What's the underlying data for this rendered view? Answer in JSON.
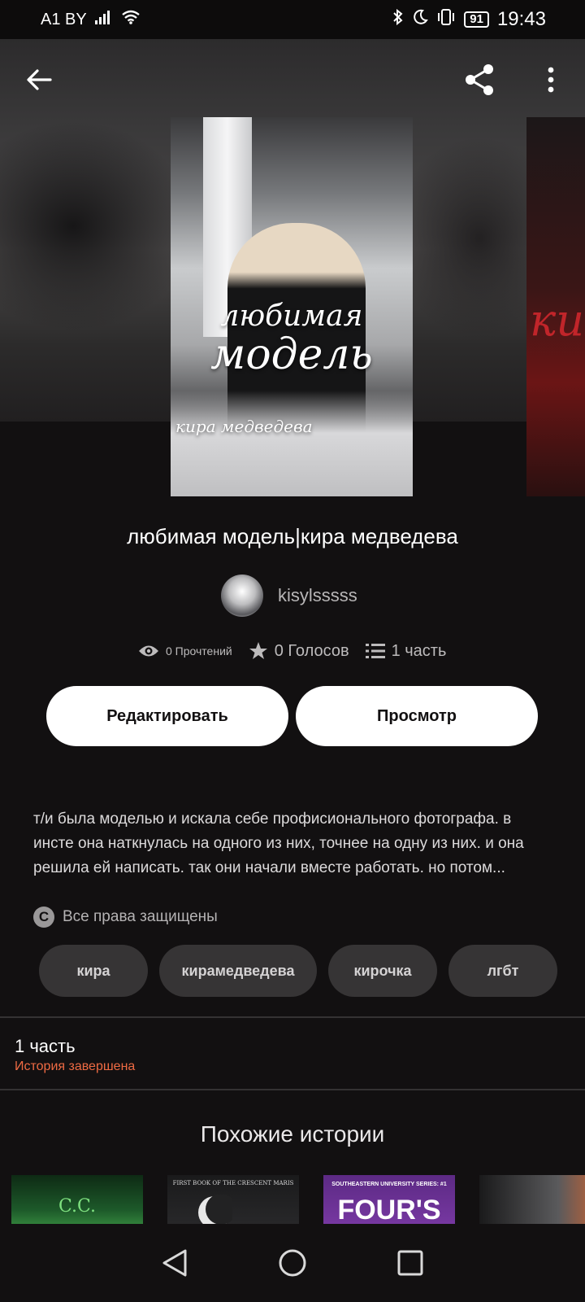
{
  "status_bar": {
    "carrier": "A1 BY",
    "battery": "91",
    "time": "19:43"
  },
  "cover": {
    "title_line1": "любимая",
    "title_line2": "модель",
    "author_line": "кира медведева",
    "next_cover_text": "ки"
  },
  "story": {
    "title": "любимая модель|кира медведева",
    "author": "kisylsssss",
    "reads": "0 Прочтений",
    "votes": "0 Голосов",
    "parts": "1 часть"
  },
  "actions": {
    "edit_label": "Редактировать",
    "view_label": "Просмотр"
  },
  "description": "т/и была моделью и искала себе профисионального фотографа. в инсте она наткнулась на одного из них, точнее на одну из них. и она решила ей написать. так они начали вместе работать. но потом...",
  "rights": {
    "icon_glyph": "C",
    "label": "Все права защищены"
  },
  "tags": [
    "кира",
    "кирамедведева",
    "кирочка",
    "лгбт"
  ],
  "parts_section": {
    "title": "1 часть",
    "status": "История завершена"
  },
  "similar": {
    "title": "Похожие истории",
    "covers": [
      {
        "text": "C.C."
      },
      {
        "text": "FIRST BOOK OF THE CRESCENT MARIS"
      },
      {
        "text_small": "SOUTHEASTERN UNIVERSITY SERIES: #1",
        "text": "FOUR'S GAME"
      },
      {
        "text": ""
      }
    ]
  },
  "colors": {
    "background": "#121011",
    "accent_status": "#ee6a43",
    "button_bg": "#ffffff"
  }
}
